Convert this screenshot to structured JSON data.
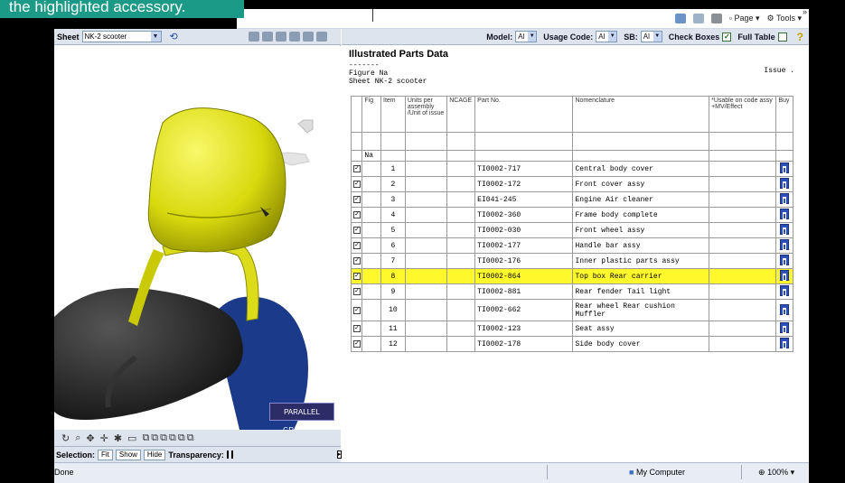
{
  "caption": "the highlighted accessory.",
  "ie_toolbar": {
    "page_label": "Page",
    "tools_label": "Tools"
  },
  "left_panel": {
    "sheet_label": "Sheet",
    "sheet_value": "NK-2 scooter",
    "logo_text": "PARALLEL GRAPHICS",
    "selection_label": "Selection:",
    "fit_label": "Fit",
    "show_label": "Show",
    "hide_label": "Hide",
    "transparency_label": "Transparency:"
  },
  "filters": {
    "model_label": "Model:",
    "model_value": "Al",
    "usage_label": "Usage Code:",
    "usage_value": "Al",
    "sb_label": "SB:",
    "sb_value": "Al",
    "checkboxes_label": "Check Boxes",
    "fulltable_label": "Full Table"
  },
  "ipd": {
    "title": "Illustrated Parts Data",
    "dashes": "-------",
    "figure": "Figure Na",
    "sheet": "Sheet NK-2 scooter",
    "issue": "Issue ."
  },
  "table": {
    "headers": [
      "",
      "Fig",
      "Item",
      "Units per assembly /Unit of issue",
      "NCAGE",
      "Part No.",
      "Nomenclature",
      "*Usable on code assy +MV/Effect",
      "Buy"
    ],
    "fig_value": "Na",
    "rows": [
      {
        "item": "1",
        "part": "TI0002-717",
        "name": "Central body cover"
      },
      {
        "item": "2",
        "part": "TI0002-172",
        "name": "Front cover assy"
      },
      {
        "item": "3",
        "part": "EI041-245",
        "name": "Engine Air cleaner"
      },
      {
        "item": "4",
        "part": "TI0002-360",
        "name": "Frame body complete"
      },
      {
        "item": "5",
        "part": "TI0002-030",
        "name": "Front wheel assy"
      },
      {
        "item": "6",
        "part": "TI0002-177",
        "name": "Handle bar assy"
      },
      {
        "item": "7",
        "part": "TI0002-176",
        "name": "Inner plastic parts assy"
      },
      {
        "item": "8",
        "part": "TI0002-864",
        "name": "Top box Rear carrier"
      },
      {
        "item": "9",
        "part": "TI0002-881",
        "name": "Rear fender Tail light"
      },
      {
        "item": "10",
        "part": "TI0002-662",
        "name": "Rear wheel Rear cushion Muffler"
      },
      {
        "item": "11",
        "part": "TI0002-123",
        "name": "Seat assy"
      },
      {
        "item": "12",
        "part": "TI0002-178",
        "name": "Side body cover"
      }
    ],
    "highlight_color": "#fff92b"
  },
  "status": {
    "done": "Done",
    "zone": "My Computer",
    "zoom": "100%"
  }
}
